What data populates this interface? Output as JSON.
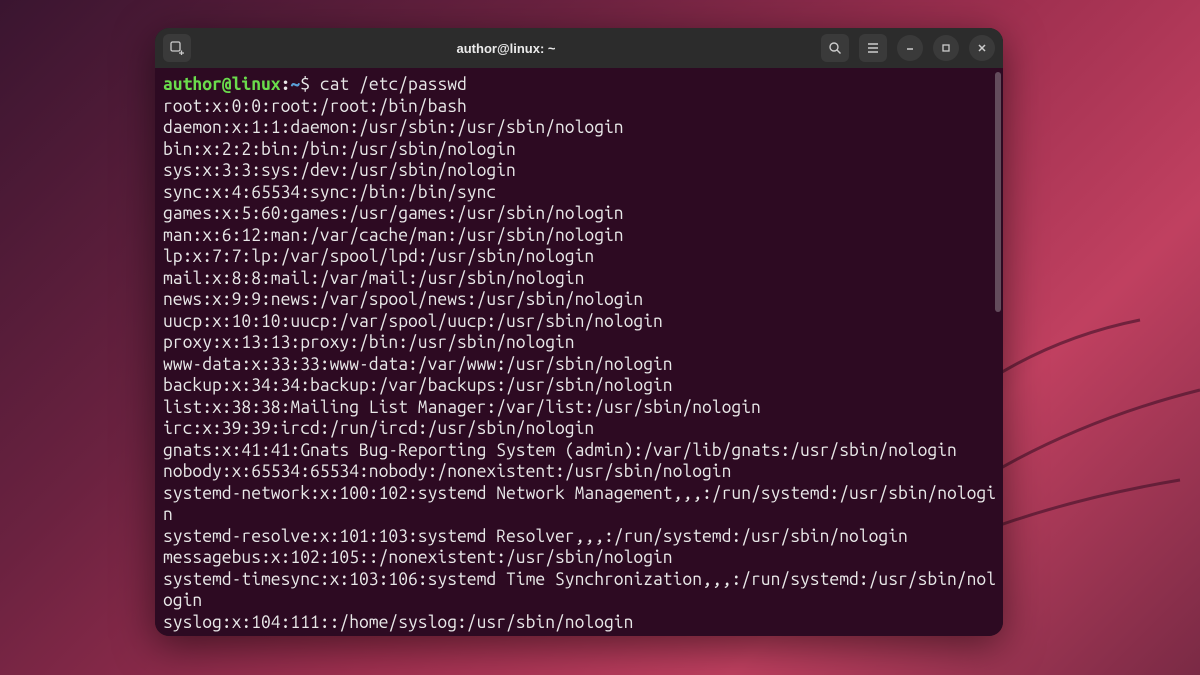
{
  "titlebar": {
    "title": "author@linux: ~"
  },
  "prompt": {
    "user_host": "author@linux",
    "path": "~",
    "symbol": "$"
  },
  "command": "cat /etc/passwd",
  "output_lines": [
    "root:x:0:0:root:/root:/bin/bash",
    "daemon:x:1:1:daemon:/usr/sbin:/usr/sbin/nologin",
    "bin:x:2:2:bin:/bin:/usr/sbin/nologin",
    "sys:x:3:3:sys:/dev:/usr/sbin/nologin",
    "sync:x:4:65534:sync:/bin:/bin/sync",
    "games:x:5:60:games:/usr/games:/usr/sbin/nologin",
    "man:x:6:12:man:/var/cache/man:/usr/sbin/nologin",
    "lp:x:7:7:lp:/var/spool/lpd:/usr/sbin/nologin",
    "mail:x:8:8:mail:/var/mail:/usr/sbin/nologin",
    "news:x:9:9:news:/var/spool/news:/usr/sbin/nologin",
    "uucp:x:10:10:uucp:/var/spool/uucp:/usr/sbin/nologin",
    "proxy:x:13:13:proxy:/bin:/usr/sbin/nologin",
    "www-data:x:33:33:www-data:/var/www:/usr/sbin/nologin",
    "backup:x:34:34:backup:/var/backups:/usr/sbin/nologin",
    "list:x:38:38:Mailing List Manager:/var/list:/usr/sbin/nologin",
    "irc:x:39:39:ircd:/run/ircd:/usr/sbin/nologin",
    "gnats:x:41:41:Gnats Bug-Reporting System (admin):/var/lib/gnats:/usr/sbin/nologin",
    "nobody:x:65534:65534:nobody:/nonexistent:/usr/sbin/nologin",
    "systemd-network:x:100:102:systemd Network Management,,,:/run/systemd:/usr/sbin/nologin",
    "systemd-resolve:x:101:103:systemd Resolver,,,:/run/systemd:/usr/sbin/nologin",
    "messagebus:x:102:105::/nonexistent:/usr/sbin/nologin",
    "systemd-timesync:x:103:106:systemd Time Synchronization,,,:/run/systemd:/usr/sbin/nologin",
    "syslog:x:104:111::/home/syslog:/usr/sbin/nologin"
  ]
}
